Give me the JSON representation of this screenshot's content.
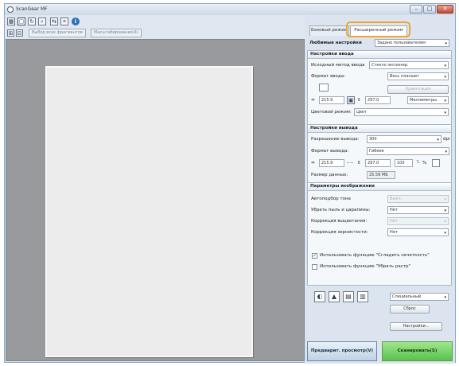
{
  "window": {
    "title": "ScanGear MF",
    "minimize": "–",
    "maximize": "□",
    "close": "✕"
  },
  "toolbar": {
    "icons": [
      "thumbnail-icon",
      "whole-image-icon",
      "rotate-icon",
      "zoom-icon",
      "mirror-icon",
      "trim-icon",
      "info-icon"
    ],
    "info_glyph": "i"
  },
  "toolbar2": {
    "select_frames": "Выбор всех фрагментов",
    "scale": "Масштабирование(4)"
  },
  "tabs": {
    "basic": "Базовый режим",
    "advanced": "Расширенный режим"
  },
  "favorites": {
    "label": "Любимые настройки",
    "value": "Задано пользователем"
  },
  "input_settings": {
    "header": "Настройки ввода",
    "source_label": "Исходный метод ввода",
    "source_value": "Стекло экспонир.",
    "size_label": "Формат ввода:",
    "size_value": "Весь планшет",
    "orientation_btn": "Ориентация",
    "width": "215.9",
    "height": "297.0",
    "unit": "Миллиметры",
    "color_label": "Цветовой режим:",
    "color_value": "Цвет"
  },
  "output_settings": {
    "header": "Настройки вывода",
    "resolution_label": "Разрешение вывода:",
    "resolution_value": "300",
    "resolution_unit": "dpi",
    "size_label": "Формат вывода:",
    "size_value": "Гибкие",
    "width": "215.9",
    "height": "297.0",
    "percent": "100",
    "percent_unit": "%",
    "data_label": "Размер данных:",
    "data_value": "25.59 МБ"
  },
  "image_settings": {
    "header": "Параметры изображения",
    "auto_tone_label": "Автоподбор тона",
    "auto_tone_value": "Выкл.",
    "dust_label": "Убрать пыль и царапины:",
    "dust_value": "Нет",
    "fading_label": "Коррекция выцветания:",
    "fading_value": "Нет",
    "grain_label": "Коррекция зернистости:",
    "grain_value": "Нет",
    "sharpen_label": "Использовать функцию \"Сгладить нечеткость\"",
    "descreen_label": "Использовать функцию \"Убрать растр\""
  },
  "tools": {
    "custom_label": "Специальный",
    "reset": "Сброс",
    "preferences": "Настройки..."
  },
  "actions": {
    "preview": "Предварит. просмотр(V)",
    "scan": "Сканировать(S)"
  }
}
